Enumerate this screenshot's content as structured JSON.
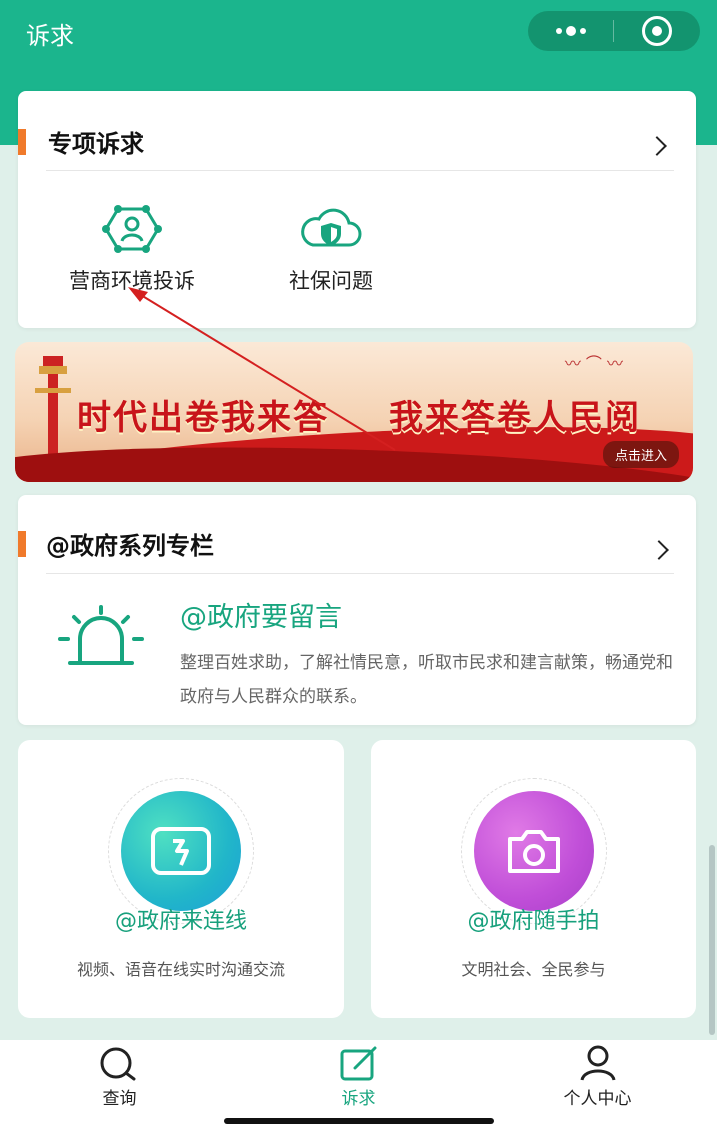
{
  "app": {
    "title": "诉求",
    "accent": "#1bb58d"
  },
  "capsule": {
    "more_icon": "more-dots-icon",
    "close_icon": "target-close-icon"
  },
  "special": {
    "title": "专项诉求",
    "items": [
      {
        "label": "营商环境投诉",
        "icon": "network-people-icon"
      },
      {
        "label": "社保问题",
        "icon": "cloud-shield-icon"
      }
    ]
  },
  "banner": {
    "left_text": "时代出卷我来答",
    "right_text": "我来答卷人民阅",
    "enter": "点击进入"
  },
  "gov": {
    "title": "@政府系列专栏",
    "feature_title": "@政府要留言",
    "feature_desc": "整理百姓求助，了解社情民意，听取市民求和建言献策，畅通党和政府与人民群众的联系。",
    "icon": "alarm-light-icon"
  },
  "tiles": [
    {
      "title": "@政府来连线",
      "sub": "视频、语音在线实时沟通交流",
      "icon": "video-call-icon",
      "color": "#2cc3c9"
    },
    {
      "title": "@政府随手拍",
      "sub": "文明社会、全民参与",
      "icon": "camera-icon",
      "color": "#c94fd6"
    }
  ],
  "tabs": [
    {
      "label": "查询",
      "icon": "search-chat-icon",
      "active": false
    },
    {
      "label": "诉求",
      "icon": "edit-icon",
      "active": true
    },
    {
      "label": "个人中心",
      "icon": "user-icon",
      "active": false
    }
  ]
}
